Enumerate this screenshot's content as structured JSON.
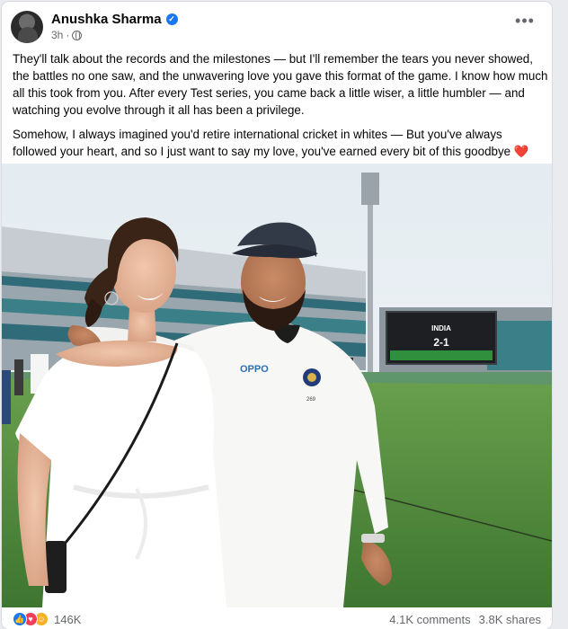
{
  "post": {
    "author": "Anushka Sharma",
    "time": "3h",
    "paragraphs": [
      "They'll talk about the records and the milestones — but I'll remember the tears you never showed, the battles no one saw, and the unwavering love you gave this format of the game. I know how much all this took from you. After every Test series, you came back a little wiser, a little humbler — and watching you evolve through it all has been a privilege.",
      "Somehow, I always imagined you'd retire international cricket in whites — But you've always followed your heart, and so I just want to say my love, you've earned every bit of this goodbye"
    ],
    "emoji": "❤️"
  },
  "photo": {
    "scoreboard_title": "INDIA",
    "scoreboard_score": "2-1",
    "shirt_logo": "OPPO",
    "shirt_number": "269"
  },
  "stats": {
    "reactions_count": "146K",
    "comments": "4.1K comments",
    "shares": "3.8K shares"
  },
  "colors": {
    "accent": "#1877f2",
    "love": "#f33e58",
    "field_green": "#4f8a3a"
  },
  "icons": [
    "verified-badge-icon",
    "globe-icon",
    "more-options-icon",
    "like-reaction-icon",
    "love-reaction-icon",
    "care-reaction-icon"
  ]
}
